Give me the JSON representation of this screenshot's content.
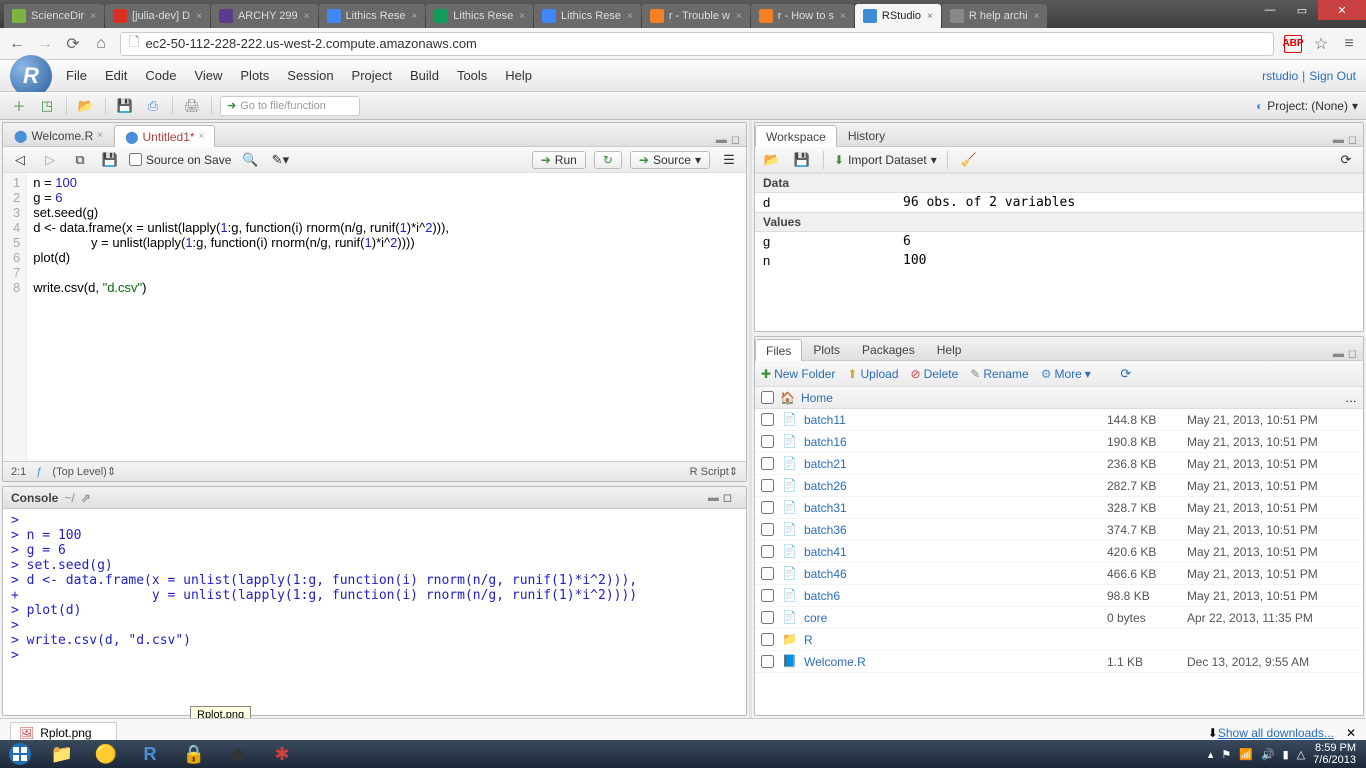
{
  "browser": {
    "tabs": [
      {
        "label": "ScienceDir",
        "fav": "#7cb342"
      },
      {
        "label": "[julia-dev] D",
        "fav": "#d93025"
      },
      {
        "label": "ARCHY 299",
        "fav": "#5b3b8c"
      },
      {
        "label": "Lithics Rese",
        "fav": "#4285f4"
      },
      {
        "label": "Lithics Rese",
        "fav": "#0f9d58"
      },
      {
        "label": "Lithics Rese",
        "fav": "#4285f4"
      },
      {
        "label": "r - Trouble w",
        "fav": "#f48024"
      },
      {
        "label": "r - How to s",
        "fav": "#f48024"
      },
      {
        "label": "RStudio",
        "fav": "#3d8dd4",
        "active": true
      },
      {
        "label": "R help archi",
        "fav": "#888"
      }
    ],
    "url": "ec2-50-112-228-222.us-west-2.compute.amazonaws.com"
  },
  "rstudio": {
    "menu": [
      "File",
      "Edit",
      "Code",
      "View",
      "Plots",
      "Session",
      "Project",
      "Build",
      "Tools",
      "Help"
    ],
    "branding_links": {
      "a": "rstudio",
      "b": "Sign Out"
    },
    "goto_placeholder": "Go to file/function",
    "project_label": "Project: (None)"
  },
  "source": {
    "tabs": [
      {
        "label": "Welcome.R",
        "active": false
      },
      {
        "label": "Untitled1*",
        "active": true
      }
    ],
    "source_on_save": "Source on Save",
    "run": "Run",
    "source_btn": "Source",
    "code_lines": [
      "n = 100",
      "g = 6",
      "set.seed(g)",
      "d <- data.frame(x = unlist(lapply(1:g, function(i) rnorm(n/g, runif(1)*i^2))),",
      "                y = unlist(lapply(1:g, function(i) rnorm(n/g, runif(1)*i^2))))",
      "plot(d)",
      "",
      "write.csv(d, \"d.csv\")"
    ],
    "cursor": "2:1",
    "scope": "(Top Level)",
    "lang": "R Script"
  },
  "console": {
    "title": "Console",
    "path": "~/",
    "lines": [
      ">",
      "> n = 100",
      "> g = 6",
      "> set.seed(g)",
      "> d <- data.frame(x = unlist(lapply(1:g, function(i) rnorm(n/g, runif(1)*i^2))),",
      "+                 y = unlist(lapply(1:g, function(i) rnorm(n/g, runif(1)*i^2))))",
      "> plot(d)",
      ">",
      "> write.csv(d, \"d.csv\")",
      "> "
    ]
  },
  "workspace": {
    "tabs": [
      "Workspace",
      "History"
    ],
    "import": "Import Dataset",
    "sections": {
      "Data": [
        {
          "name": "d",
          "value": "96 obs. of 2 variables"
        }
      ],
      "Values": [
        {
          "name": "g",
          "value": "6"
        },
        {
          "name": "n",
          "value": "100"
        }
      ]
    }
  },
  "files": {
    "tabs": [
      "Files",
      "Plots",
      "Packages",
      "Help"
    ],
    "toolbar": {
      "new": "New Folder",
      "upload": "Upload",
      "delete": "Delete",
      "rename": "Rename",
      "more": "More"
    },
    "crumb": "Home",
    "rows": [
      {
        "name": "batch11",
        "size": "144.8 KB",
        "date": "May 21, 2013, 10:51 PM",
        "icon": "file"
      },
      {
        "name": "batch16",
        "size": "190.8 KB",
        "date": "May 21, 2013, 10:51 PM",
        "icon": "file"
      },
      {
        "name": "batch21",
        "size": "236.8 KB",
        "date": "May 21, 2013, 10:51 PM",
        "icon": "file"
      },
      {
        "name": "batch26",
        "size": "282.7 KB",
        "date": "May 21, 2013, 10:51 PM",
        "icon": "file"
      },
      {
        "name": "batch31",
        "size": "328.7 KB",
        "date": "May 21, 2013, 10:51 PM",
        "icon": "file"
      },
      {
        "name": "batch36",
        "size": "374.7 KB",
        "date": "May 21, 2013, 10:51 PM",
        "icon": "file"
      },
      {
        "name": "batch41",
        "size": "420.6 KB",
        "date": "May 21, 2013, 10:51 PM",
        "icon": "file"
      },
      {
        "name": "batch46",
        "size": "466.6 KB",
        "date": "May 21, 2013, 10:51 PM",
        "icon": "file"
      },
      {
        "name": "batch6",
        "size": "98.8 KB",
        "date": "May 21, 2013, 10:51 PM",
        "icon": "file"
      },
      {
        "name": "core",
        "size": "0 bytes",
        "date": "Apr 22, 2013, 11:35 PM",
        "icon": "file"
      },
      {
        "name": "R",
        "size": "",
        "date": "",
        "icon": "folder"
      },
      {
        "name": "Welcome.R",
        "size": "1.1 KB",
        "date": "Dec 13, 2012, 9:55 AM",
        "icon": "rfile"
      }
    ]
  },
  "download": {
    "chip": "Rplot.png",
    "tooltip": "Rplot.png",
    "show_all": "Show all downloads..."
  },
  "clock": {
    "time": "8:59 PM",
    "date": "7/6/2013"
  }
}
